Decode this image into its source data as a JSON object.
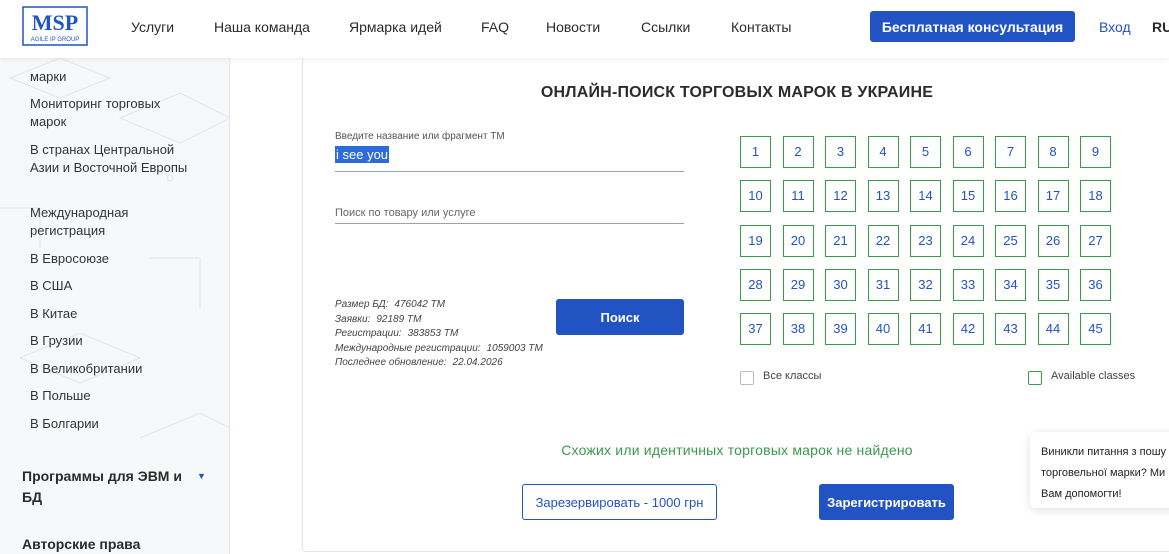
{
  "header": {
    "logo_text": "MSP",
    "logo_subtext": "AGILE IP GROUP",
    "nav": [
      "Услуги",
      "Наша команда",
      "Ярмарка идей",
      "FAQ",
      "Новости",
      "Ссылки",
      "Контакты"
    ],
    "cta_label": "Бесплатная консультация",
    "login_label": "Вход",
    "lang": "RU"
  },
  "sidebar": {
    "items": [
      {
        "label": "марки"
      },
      {
        "label": "Мониторинг торговых марок"
      },
      {
        "label": "В странах Центральной Азии и Восточной Европы"
      },
      {
        "label": "Международная регистрация"
      },
      {
        "label": "В Евросоюзе"
      },
      {
        "label": "В США"
      },
      {
        "label": "В Китае"
      },
      {
        "label": "В Грузии"
      },
      {
        "label": "В Великобритании"
      },
      {
        "label": "В Польше"
      },
      {
        "label": "В Болгарии"
      }
    ],
    "headings": [
      {
        "label": "Программы для ЭВМ и БД"
      },
      {
        "label": "Авторские права"
      }
    ]
  },
  "search": {
    "title": "ОНЛАЙН-ПОИСК ТОРГОВЫХ МАРОК В УКРАИНЕ",
    "name_label": "Введите название или фрагмент ТМ",
    "name_value": "i see you",
    "goods_placeholder": "Поиск по товару или услуге",
    "search_button": "Поиск"
  },
  "stats": {
    "db_size_label": "Размер БД:",
    "db_size_value": "476042 ТМ",
    "apps_label": "Заявки:",
    "apps_value": "92189 ТМ",
    "regs_label": "Регистрации:",
    "regs_value": "383853 ТМ",
    "intl_label": "Международные регистрации:",
    "intl_value": "1059003 ТМ",
    "updated_label": "Последнее обновление:",
    "updated_value": "22.04.2026"
  },
  "classes": [
    "1",
    "2",
    "3",
    "4",
    "5",
    "6",
    "7",
    "8",
    "9",
    "10",
    "11",
    "12",
    "13",
    "14",
    "15",
    "16",
    "17",
    "18",
    "19",
    "20",
    "21",
    "22",
    "23",
    "24",
    "25",
    "26",
    "27",
    "28",
    "29",
    "30",
    "31",
    "32",
    "33",
    "34",
    "35",
    "36",
    "37",
    "38",
    "39",
    "40",
    "41",
    "42",
    "43",
    "44",
    "45"
  ],
  "options": {
    "all_classes": "Все классы",
    "available_classes": "Available classes"
  },
  "result": {
    "not_found": "Схожих или идентичных торговых марок не найдено",
    "reserve_button": "Зарезервировать - 1000 грн",
    "register_button": "Зарегистрировать"
  },
  "chat": {
    "line1": "Виникли питання з пошу",
    "line2": "торговельної марки? Ми",
    "line3": "Вам допомогти!"
  },
  "colors": {
    "primary": "#2253c3",
    "success": "#3a9a4c"
  }
}
